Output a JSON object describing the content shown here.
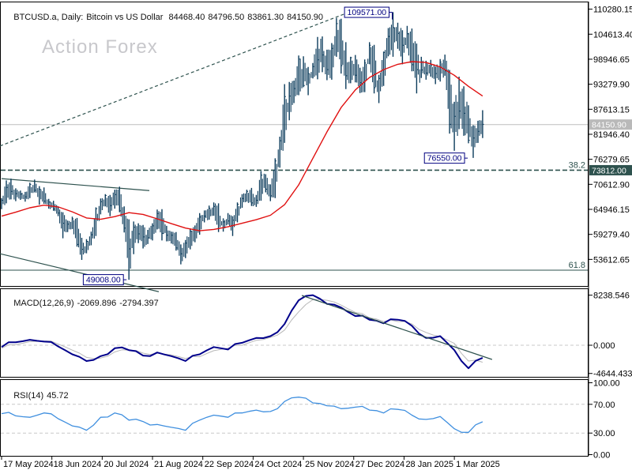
{
  "window": {
    "symbol_period": "BTCUSD.a, Daily:",
    "description": "Bitcoin vs US Dollar",
    "open": "84468.40",
    "high": "84796.50",
    "low": "83861.30",
    "close": "84150.90"
  },
  "watermark": {
    "text": "Action Forex"
  },
  "date_axis": {
    "labels": [
      {
        "text": "17 May 2024",
        "day": 0
      },
      {
        "text": "18 Jun 2024",
        "day": 32
      },
      {
        "text": "20 Jul 2024",
        "day": 64
      },
      {
        "text": "21 Aug 2024",
        "day": 96
      },
      {
        "text": "22 Sep 2024",
        "day": 128
      },
      {
        "text": "24 Oct 2024",
        "day": 160
      },
      {
        "text": "25 Nov 2024",
        "day": 192
      },
      {
        "text": "27 Dec 2024",
        "day": 224
      },
      {
        "text": "28 Jan 2025",
        "day": 256
      },
      {
        "text": "1 Mar 2025",
        "day": 288
      }
    ]
  },
  "chart_data": [
    {
      "id": "price",
      "type": "ohlc-bars",
      "title": "BTCUSD.a Daily — Bitcoin vs US Dollar",
      "units": "USD, values in thousands",
      "sampling": "~3-day bars estimated from pixels, 17 May 2024 to 20 Mar 2025",
      "bar_day_step": 3,
      "high": [
        67.5,
        71.5,
        71.9,
        69.7,
        69.2,
        68.9,
        71.0,
        71.7,
        70.2,
        69.9,
        67.3,
        66.9,
        65.6,
        64.3,
        62.4,
        63.3,
        63.0,
        58.5,
        58.2,
        59.9,
        65.4,
        67.4,
        68.4,
        68.2,
        69.4,
        70.1,
        65.6,
        62.7,
        62.2,
        61.8,
        61.4,
        60.3,
        61.8,
        64.9,
        65.0,
        61.2,
        59.9,
        59.8,
        57.0,
        58.0,
        60.6,
        61.3,
        64.1,
        64.7,
        65.8,
        66.5,
        66.3,
        62.9,
        64.1,
        63.4,
        66.5,
        68.4,
        69.4,
        69.8,
        68.2,
        73.6,
        72.9,
        70.6,
        76.5,
        81.4,
        93.3,
        93.8,
        94.1,
        99.8,
        99.6,
        97.2,
        98.1,
        104.0,
        104.1,
        101.1,
        102.6,
        108.3,
        108.1,
        102.8,
        99.5,
        99.9,
        97.0,
        98.9,
        102.8,
        102.2,
        95.4,
        100.7,
        106.0,
        109.6,
        107.2,
        105.5,
        106.5,
        105.9,
        102.5,
        99.5,
        98.6,
        98.8,
        97.3,
        99.0,
        100.0,
        96.5,
        89.3,
        95.0,
        92.8,
        88.5,
        84.0,
        85.0,
        87.4
      ],
      "low": [
        65.0,
        66.3,
        67.2,
        66.8,
        67.1,
        66.7,
        67.5,
        68.8,
        66.0,
        66.2,
        65.1,
        64.6,
        63.4,
        58.4,
        59.8,
        60.5,
        56.5,
        53.5,
        55.0,
        56.8,
        58.9,
        63.8,
        65.6,
        63.4,
        65.1,
        64.3,
        59.7,
        49.0,
        54.8,
        57.3,
        56.1,
        57.1,
        57.9,
        60.4,
        57.9,
        57.7,
        57.2,
        55.6,
        52.5,
        53.9,
        55.9,
        57.5,
        59.2,
        62.0,
        62.6,
        63.5,
        59.8,
        59.9,
        61.5,
        58.9,
        62.0,
        65.3,
        66.7,
        65.7,
        65.5,
        66.9,
        68.8,
        66.8,
        67.5,
        74.4,
        80.0,
        85.1,
        89.0,
        90.8,
        92.6,
        90.8,
        94.6,
        94.4,
        96.0,
        94.2,
        94.3,
        99.5,
        95.7,
        92.2,
        93.5,
        93.7,
        91.3,
        91.5,
        97.8,
        91.2,
        89.0,
        92.9,
        99.6,
        99.5,
        101.3,
        97.8,
        101.4,
        96.2,
        91.2,
        94.7,
        94.3,
        95.0,
        93.3,
        93.9,
        95.2,
        82.1,
        78.2,
        83.1,
        81.6,
        79.9,
        76.6,
        80.0,
        81.1
      ],
      "close": [
        67.0,
        69.9,
        69.0,
        68.5,
        68.4,
        67.8,
        70.6,
        69.3,
        69.5,
        66.8,
        66.6,
        65.0,
        64.1,
        61.8,
        61.6,
        62.8,
        57.0,
        55.9,
        57.7,
        59.2,
        65.1,
        66.7,
        68.1,
        65.8,
        68.3,
        64.6,
        60.7,
        56.0,
        60.9,
        59.4,
        58.7,
        58.5,
        61.2,
        64.0,
        59.5,
        59.1,
        59.1,
        56.2,
        54.9,
        57.3,
        60.0,
        60.3,
        63.2,
        63.4,
        65.2,
        65.6,
        60.6,
        62.1,
        62.3,
        62.5,
        66.1,
        67.4,
        69.0,
        66.4,
        67.0,
        72.7,
        69.5,
        68.0,
        75.9,
        80.5,
        90.5,
        90.6,
        92.3,
        99.0,
        93.0,
        95.7,
        97.3,
        98.8,
        99.9,
        96.6,
        101.4,
        107.0,
        97.5,
        95.2,
        99.3,
        95.3,
        93.6,
        98.1,
        102.1,
        92.5,
        94.6,
        100.5,
        104.1,
        106.1,
        104.8,
        102.1,
        104.7,
        97.7,
        96.6,
        96.5,
        95.8,
        97.5,
        95.7,
        98.3,
        96.3,
        84.2,
        86.0,
        87.2,
        86.7,
        80.6,
        81.1,
        82.6,
        84.2
      ],
      "ma_red": {
        "day_step": 9,
        "values": [
          63.4,
          64.3,
          65.3,
          65.9,
          65.5,
          64.4,
          63.0,
          62.7,
          63.3,
          64.2,
          63.8,
          62.8,
          61.7,
          60.7,
          60.1,
          60.4,
          61.0,
          61.8,
          62.6,
          63.6,
          66.0,
          70.5,
          76.5,
          82.5,
          88.0,
          92.0,
          94.8,
          96.6,
          97.8,
          98.4,
          98.2,
          97.2,
          95.3,
          92.8,
          90.6
        ]
      },
      "axis_ticks": [
        110280.15,
        104613.4,
        98946.65,
        93279.9,
        87613.15,
        81946.4,
        76279.65,
        70612.9,
        64946.15,
        59279.4,
        53612.65
      ],
      "price_labels": [
        {
          "text": "109571.00",
          "day": 249,
          "price": 109.571,
          "connector": "hook"
        },
        {
          "text": "76550.00",
          "day": 297,
          "price": 76.55,
          "connector": "flat"
        },
        {
          "text": "49008.00",
          "day": 80,
          "price": 49.008,
          "connector": "flat"
        }
      ],
      "hlines": [
        {
          "price": 84.1509,
          "style": "solid",
          "color": "#c6c6c6",
          "axis_label": "84150.90",
          "axis_bg": "#b9b9b9"
        },
        {
          "price": 73.812,
          "style": "dashed",
          "color": "#2e524e",
          "tag": "38.2",
          "axis_label": "73812.00",
          "axis_bg": "#2e524e"
        },
        {
          "price": 51.17,
          "style": "solid",
          "color": "#2e524e",
          "tag": "61.8"
        }
      ],
      "trendlines": [
        {
          "d1": -1,
          "p1": 79.3,
          "d2": 224,
          "p2": 110.0,
          "style": "dashed"
        },
        {
          "d1": 0,
          "p1": 71.9,
          "d2": 94,
          "p2": 69.2,
          "style": "solid"
        },
        {
          "d1": -1,
          "p1": 54.9,
          "d2": 100,
          "p2": 46.3,
          "style": "solid"
        }
      ],
      "colors": {
        "bars": "#0c3c5c",
        "ma": "#e01010",
        "objects": "#2e524e",
        "label_box": "#000080"
      }
    },
    {
      "id": "macd",
      "type": "line",
      "label_name": "MACD(12,26,9)",
      "label_values": [
        "-2069.896",
        "-2794.397"
      ],
      "day_step": 9,
      "values_main": [
        -300,
        500,
        900,
        600,
        -200,
        -1500,
        -2600,
        -1800,
        -500,
        -800,
        -1700,
        -1200,
        -1800,
        -2600,
        -1500,
        -300,
        -700,
        400,
        1200,
        1500,
        3500,
        7400,
        8238,
        6800,
        6200,
        4800,
        4200,
        3600,
        4200,
        3200,
        1200,
        1500,
        -800,
        -3800,
        -2069.896
      ],
      "values_signal": [
        -500,
        100,
        600,
        700,
        200,
        -800,
        -2000,
        -2100,
        -1100,
        -800,
        -1300,
        -1300,
        -1600,
        -2200,
        -1900,
        -900,
        -500,
        0,
        800,
        1300,
        2500,
        5500,
        7500,
        7400,
        6600,
        5400,
        4500,
        3900,
        3900,
        3500,
        2100,
        1400,
        300,
        -2600,
        -2794.397
      ],
      "axis_ticks": [
        8238.546,
        0.0,
        -4644.433
      ],
      "trendline": {
        "d1": 191,
        "v1": 8190,
        "d2": 312,
        "v2": -2340
      },
      "colors": {
        "main": "#00008b",
        "signal": "#b8b8b8",
        "zero": "#c8c8c8",
        "trendline": "#2e524e"
      }
    },
    {
      "id": "rsi",
      "type": "line",
      "label_name": "RSI(14)",
      "label_values": [
        "45.72"
      ],
      "day_step": 9,
      "values": [
        57,
        54,
        52,
        58,
        50,
        40,
        34,
        52,
        58,
        48,
        46,
        42,
        38,
        34,
        48,
        55,
        52,
        58,
        62,
        60,
        74,
        80,
        72,
        68,
        64,
        66,
        62,
        58,
        63,
        55,
        49,
        53,
        36,
        31,
        45.72
      ],
      "levels": [
        70,
        30
      ],
      "axis_ticks": [
        100.0,
        70.0,
        30.0,
        0.0
      ],
      "colors": {
        "line": "#3f8fdf",
        "levels": "#c8c8c8"
      }
    }
  ]
}
